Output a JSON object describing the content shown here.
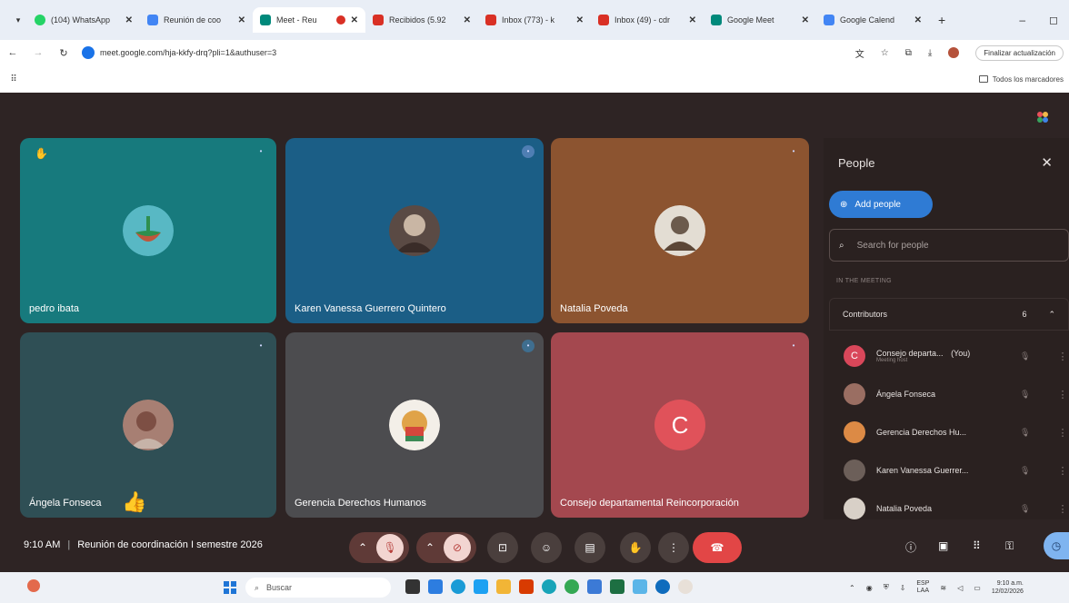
{
  "browser": {
    "tabs": [
      {
        "label": "(104) WhatsApp",
        "color": "#25d366"
      },
      {
        "label": "Reunión de coo",
        "color": "#4285f4"
      },
      {
        "label": "Meet - Reu",
        "color": "#00897b",
        "active": true
      },
      {
        "label": "Recibidos (5.92",
        "color": "#d93025"
      },
      {
        "label": "Inbox (773) - k",
        "color": "#d93025"
      },
      {
        "label": "Inbox (49) - cdr",
        "color": "#d93025"
      },
      {
        "label": "Google Meet",
        "color": "#00897b"
      },
      {
        "label": "Google Calend",
        "color": "#4285f4"
      }
    ],
    "url": "meet.google.com/hja-kkfy-drq?pli=1&authuser=3",
    "update_button": "Finalizar actualización",
    "bookmarks_label": "Todos los marcadores"
  },
  "meeting": {
    "tiles": [
      {
        "name": "pedro ibata",
        "bg": "#177a7d"
      },
      {
        "name": "Karen Vanessa Guerrero Quintero",
        "bg": "#1b5e86"
      },
      {
        "name": "Natalia Poveda",
        "bg": "#8c5430"
      },
      {
        "name": "Ángela Fonseca",
        "bg": "#2f4f55"
      },
      {
        "name": "Gerencia Derechos Humanos",
        "bg": "#4c4c4f"
      },
      {
        "name": "Consejo departamental Reincorporación",
        "bg": "#a4484f",
        "letter": "C"
      }
    ],
    "time": "9:10 AM",
    "title": "Reunión de coordinación I semestre 2026"
  },
  "people_panel": {
    "title": "People",
    "add_people": "Add people",
    "search_placeholder": "Search for people",
    "section_label": "IN THE MEETING",
    "contributors_label": "Contributors",
    "contributors_count": "6",
    "people": [
      {
        "name": "Consejo departa...",
        "you": "(You)",
        "sub": "Meeting host",
        "letter": "C"
      },
      {
        "name": "Ángela Fonseca"
      },
      {
        "name": "Gerencia Derechos Hu..."
      },
      {
        "name": "Karen Vanessa Guerrer..."
      },
      {
        "name": "Natalia Poveda"
      }
    ]
  },
  "taskbar": {
    "search": "Buscar",
    "lang_top": "ESP",
    "lang_bottom": "LAA",
    "time": "9:10 a.m.",
    "date": "12/02/2026"
  }
}
